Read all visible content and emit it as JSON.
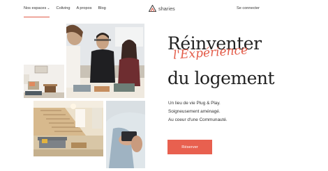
{
  "nav": {
    "items": [
      {
        "label": "Nos espaces",
        "has_dropdown": true
      },
      {
        "label": "Coliving"
      },
      {
        "label": "A propos"
      },
      {
        "label": "Blog"
      }
    ],
    "login_label": "Se connecter"
  },
  "brand": {
    "name": "shar­ies",
    "display": "sharies",
    "accent": "#e35a47"
  },
  "hero": {
    "title_line1": "Réinventer",
    "title_script": "l'Expérience",
    "title_line3": "du logement",
    "subtitle": [
      "Un lieu de vie Plug & Play.",
      "Soigneusement aménagé.",
      "Au coeur d'une Communauté."
    ],
    "cta_label": "Réserver"
  },
  "colors": {
    "accent": "#e35a47",
    "button": "#e8604f",
    "text": "#222222"
  }
}
